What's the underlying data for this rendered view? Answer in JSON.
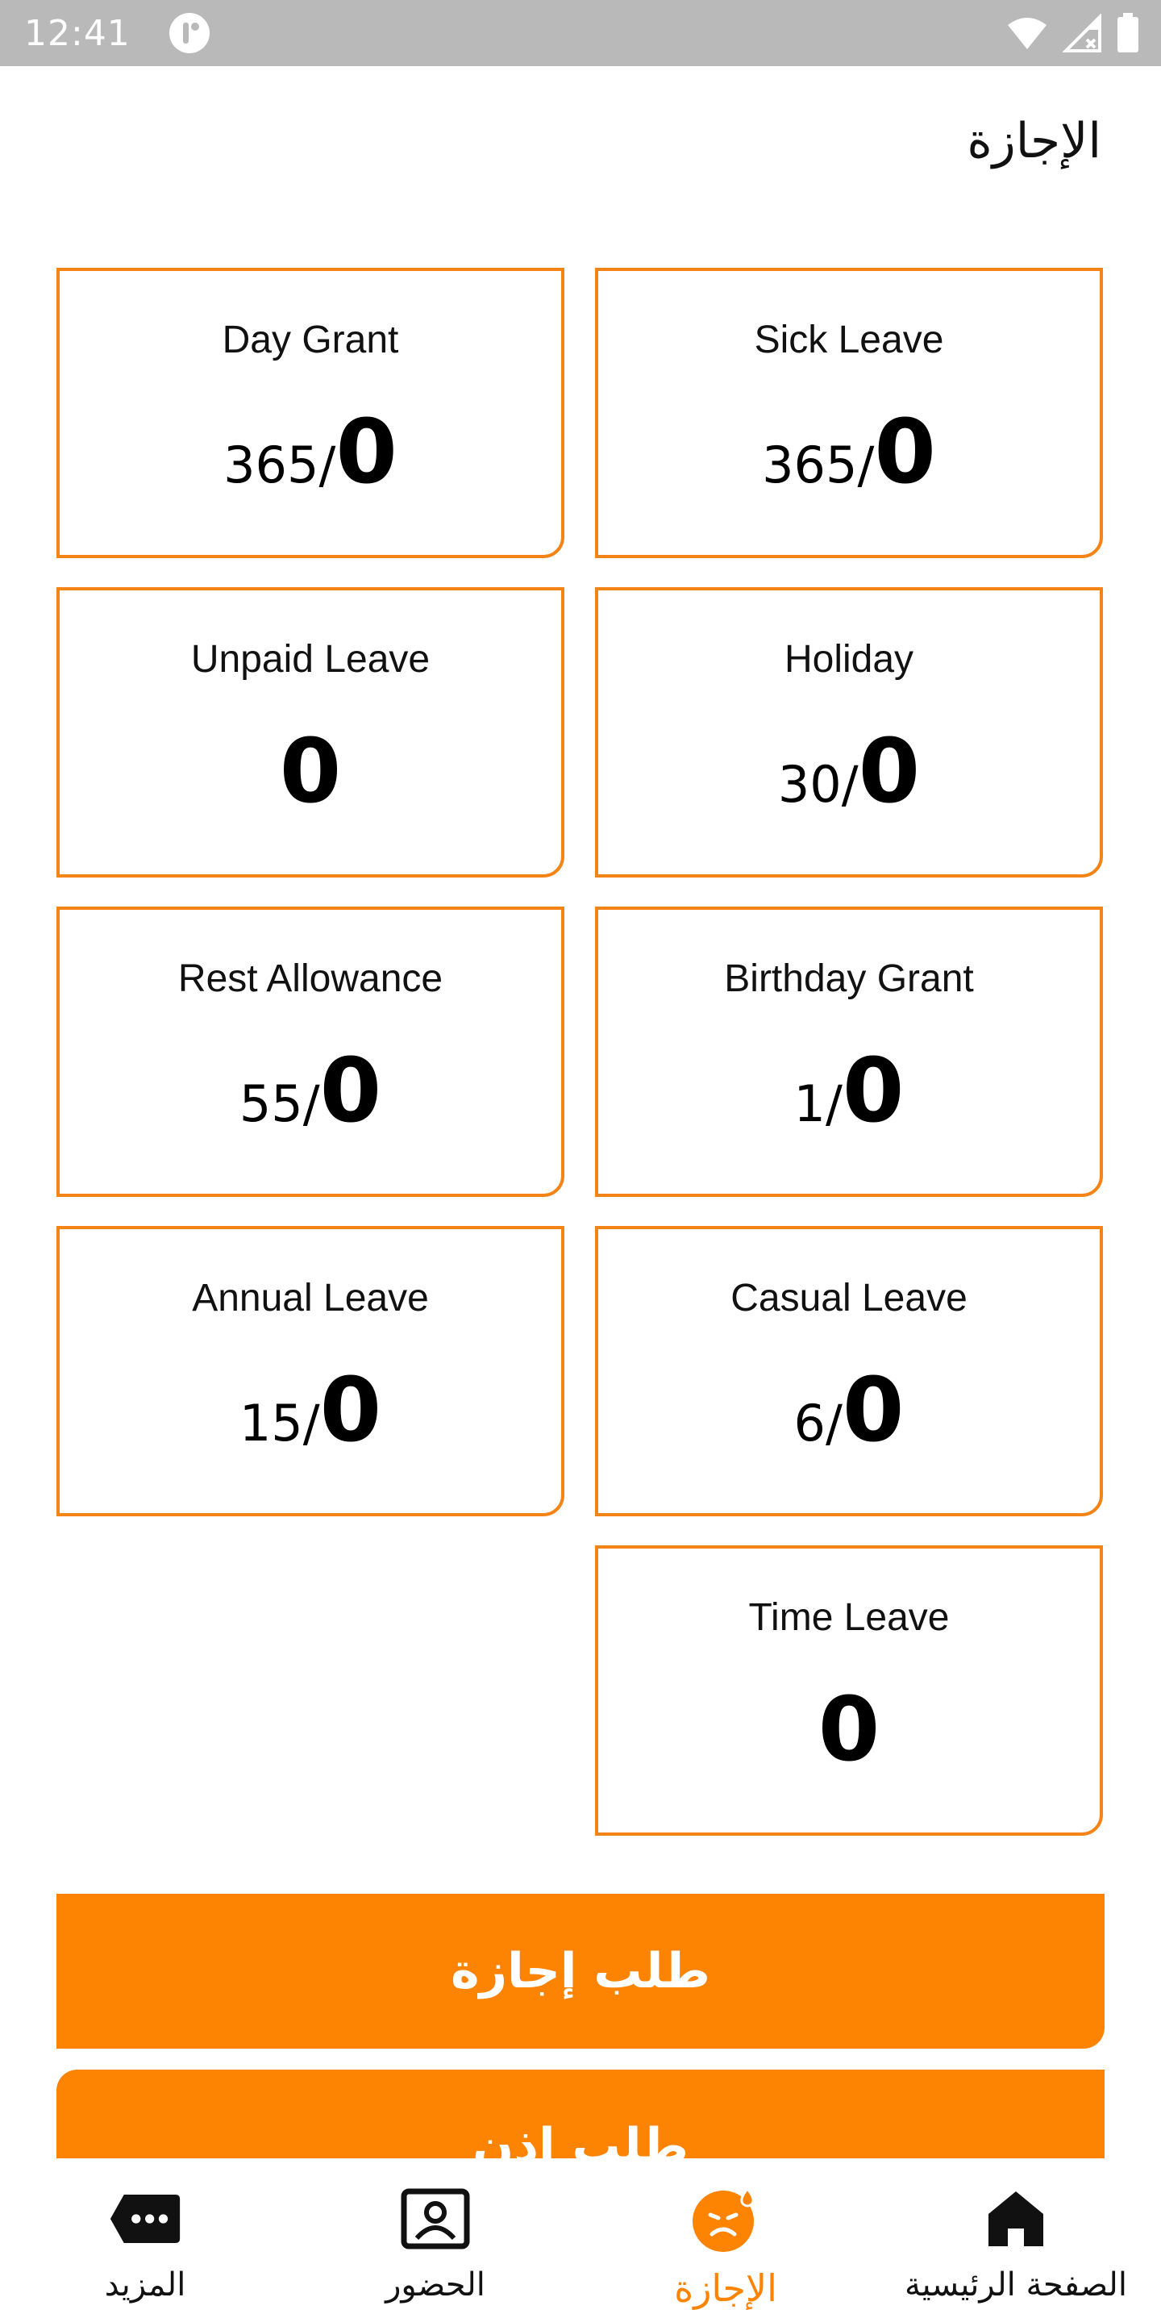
{
  "status_bar": {
    "time": "12:41"
  },
  "header": {
    "title": "الإجازة"
  },
  "cards": [
    {
      "title": "Sick Leave",
      "total": "365/",
      "used": "0"
    },
    {
      "title": "Day Grant",
      "total": "365/",
      "used": "0"
    },
    {
      "title": "Holiday",
      "total": "30/",
      "used": "0"
    },
    {
      "title": "Unpaid Leave",
      "total": "",
      "used": "0"
    },
    {
      "title": "Birthday Grant",
      "total": "1/",
      "used": "0"
    },
    {
      "title": "Rest Allowance",
      "total": "55/",
      "used": "0"
    },
    {
      "title": "Casual Leave",
      "total": "6/",
      "used": "0"
    },
    {
      "title": "Annual Leave",
      "total": "15/",
      "used": "0"
    },
    {
      "title": "Time Leave",
      "total": "",
      "used": "0"
    }
  ],
  "actions": {
    "request_leave": "طلب إجازة",
    "request_permission": "طلب إذن"
  },
  "bottom_nav": {
    "items": [
      {
        "label": "المزيد",
        "icon": "more-icon"
      },
      {
        "label": "الحضور",
        "icon": "attendance-icon"
      },
      {
        "label": "الإجازة",
        "icon": "leave-icon",
        "active": true
      },
      {
        "label": "الصفحة الرئيسية",
        "icon": "home-icon"
      }
    ]
  },
  "colors": {
    "accent": "#fd8303",
    "card_border": "#f58416",
    "status_bar": "#b9b9b9"
  }
}
